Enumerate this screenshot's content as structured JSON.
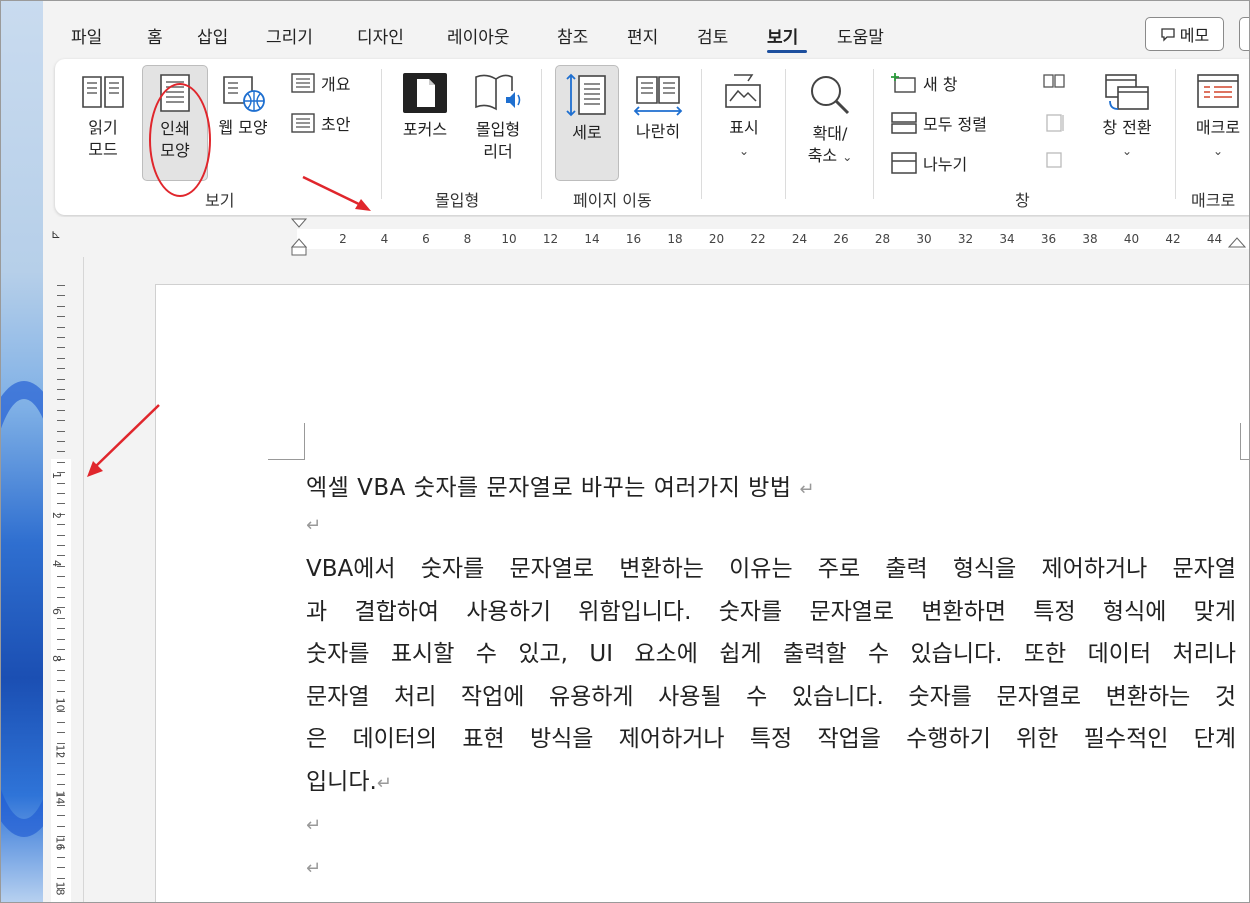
{
  "tabs": [
    "파일",
    "홈",
    "삽입",
    "그리기",
    "디자인",
    "레이아웃",
    "참조",
    "편지",
    "검토",
    "보기",
    "도움말"
  ],
  "active_tab": "보기",
  "memo_label": "메모",
  "ribbon": {
    "groups": {
      "view": {
        "label": "보기",
        "read_mode": "읽기 모드",
        "read_mode_l1": "읽기",
        "read_mode_l2": "모드",
        "print_layout_l1": "인쇄",
        "print_layout_l2": "모양",
        "web_layout": "웹 모양",
        "outline": "개요",
        "draft": "초안"
      },
      "immersive": {
        "label": "몰입형",
        "focus": "포커스",
        "reader_l1": "몰입형",
        "reader_l2": "리더"
      },
      "page_move": {
        "label": "페이지 이동",
        "vertical": "세로",
        "side": "나란히"
      },
      "show": {
        "show": "표시"
      },
      "zoom": {
        "zoom_l1": "확대/",
        "zoom_l2": "축소"
      },
      "window": {
        "label": "창",
        "new": "새 창",
        "arrange": "모두 정렬",
        "split": "나누기",
        "switch": "창 전환"
      },
      "macro": {
        "label": "매크로",
        "btn": "매크로"
      }
    }
  },
  "ruler_ticks": [
    "2",
    "4",
    "6",
    "8",
    "10",
    "12",
    "14",
    "16",
    "18",
    "20",
    "22",
    "24",
    "26",
    "28",
    "30",
    "32",
    "34",
    "36",
    "38",
    "40",
    "42",
    "44"
  ],
  "vruler_ticks": [
    "1",
    "2",
    "4",
    "6",
    "8",
    "10",
    "12",
    "14",
    "16",
    "18"
  ],
  "document": {
    "title": "엑셀 VBA 숫자를 문자열로 바꾸는 여러가지 방법",
    "para_lines": [
      "VBA에서 숫자를 문자열로 변환하는 이유는 주로 출력 형식을 제어하거나 문자열",
      "과 결합하여 사용하기 위함입니다. 숫자를 문자열로 변환하면 특정 형식에 맞게",
      "숫자를 표시할 수 있고, UI 요소에 쉽게 출력할 수 있습니다. 또한 데이터 처리나",
      "문자열 처리 작업에 유용하게 사용될 수 있습니다. 숫자를 문자열로 변환하는 것",
      "은 데이터의 표현 방식을 제어하거나 특정 작업을 수행하기 위한 필수적인 단계",
      "입니다."
    ]
  },
  "colors": {
    "accent": "#1d4f9e",
    "annotation": "#e0262c"
  }
}
